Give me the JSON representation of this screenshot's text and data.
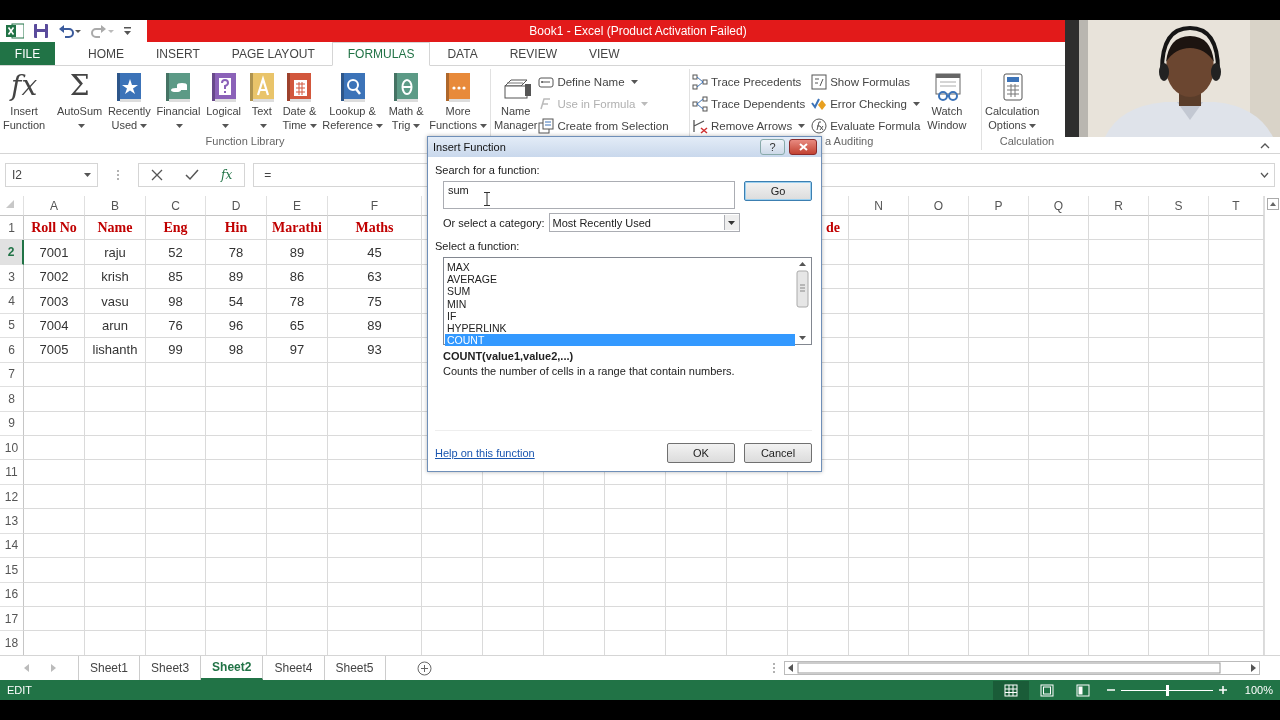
{
  "title_bar": {
    "title": "Book1 - Excel (Product Activation Failed)"
  },
  "ribbon_tabs": [
    {
      "label": "FILE",
      "kind": "file",
      "selected": false
    },
    {
      "label": "HOME",
      "kind": "tab",
      "selected": false
    },
    {
      "label": "INSERT",
      "kind": "tab",
      "selected": false
    },
    {
      "label": "PAGE LAYOUT",
      "kind": "tab",
      "selected": false
    },
    {
      "label": "FORMULAS",
      "kind": "tab",
      "selected": true
    },
    {
      "label": "DATA",
      "kind": "tab",
      "selected": false
    },
    {
      "label": "REVIEW",
      "kind": "tab",
      "selected": false
    },
    {
      "label": "VIEW",
      "kind": "tab",
      "selected": false
    }
  ],
  "ribbon": {
    "groups": [
      {
        "label": "Function Library",
        "items": [
          {
            "kind": "big",
            "glyph": "fx",
            "lines": [
              "Insert",
              "Function"
            ],
            "dropdown": false
          },
          {
            "kind": "big",
            "glyph": "Σ",
            "lines": [
              "AutoSum"
            ],
            "dropdown": true
          },
          {
            "kind": "big",
            "lines": [
              "Recently",
              "Used"
            ],
            "dropdown": true
          },
          {
            "kind": "big",
            "lines": [
              "Financial"
            ],
            "dropdown": true
          },
          {
            "kind": "big",
            "lines": [
              "Logical"
            ],
            "dropdown": true
          },
          {
            "kind": "big",
            "lines": [
              "Text"
            ],
            "dropdown": true
          },
          {
            "kind": "big",
            "lines": [
              "Date &",
              "Time"
            ],
            "dropdown": true
          },
          {
            "kind": "big",
            "lines": [
              "Lookup &",
              "Reference"
            ],
            "dropdown": true
          },
          {
            "kind": "big",
            "lines": [
              "Math &",
              "Trig"
            ],
            "dropdown": true
          },
          {
            "kind": "big",
            "lines": [
              "More",
              "Functions"
            ],
            "dropdown": true
          }
        ]
      },
      {
        "items": [
          {
            "kind": "big",
            "lines": [
              "Name",
              "Manager"
            ],
            "dropdown": false
          },
          {
            "kind": "stack",
            "items": [
              {
                "label": "Define Name",
                "dropdown": true,
                "disabled": false
              },
              {
                "label": "Use in Formula",
                "dropdown": true,
                "disabled": true
              },
              {
                "label": "Create from Selection",
                "dropdown": false,
                "disabled": false
              }
            ]
          }
        ]
      },
      {
        "label": "a Auditing",
        "items": [
          {
            "kind": "stack",
            "items": [
              {
                "label": "Trace Precedents",
                "dropdown": false,
                "disabled": false
              },
              {
                "label": "Trace Dependents",
                "dropdown": false,
                "disabled": false
              },
              {
                "label": "Remove Arrows",
                "dropdown": true,
                "disabled": false
              }
            ]
          },
          {
            "kind": "stack",
            "items": [
              {
                "label": "Show Formulas",
                "dropdown": false,
                "disabled": false
              },
              {
                "label": "Error Checking",
                "dropdown": true,
                "disabled": false
              },
              {
                "label": "Evaluate Formula",
                "dropdown": false,
                "disabled": false
              }
            ]
          },
          {
            "kind": "big",
            "lines": [
              "Watch",
              "Window"
            ],
            "dropdown": false
          }
        ]
      },
      {
        "label": "Calculation",
        "items": [
          {
            "kind": "big",
            "lines": [
              "Calculation",
              "Options"
            ],
            "dropdown": true
          }
        ]
      }
    ]
  },
  "formula_bar": {
    "name_box": "I2",
    "function_glyph": "fx",
    "formula": "="
  },
  "sheet": {
    "left_columns": [
      "A",
      "B",
      "C",
      "D",
      "E",
      "F"
    ],
    "right_columns": [
      "N",
      "O",
      "P",
      "Q",
      "R",
      "S",
      "T"
    ],
    "rows": [
      {
        "number": "1",
        "selected": false,
        "kind": "header",
        "cells": [
          "Roll No",
          "Name",
          "Eng",
          "Hin",
          "Marathi",
          "Maths"
        ],
        "column_m": "de"
      },
      {
        "number": "2",
        "selected": true,
        "kind": "data",
        "cells": [
          "7001",
          "raju",
          "52",
          "78",
          "89",
          "45"
        ]
      },
      {
        "number": "3",
        "selected": false,
        "kind": "data",
        "cells": [
          "7002",
          "krish",
          "85",
          "89",
          "86",
          "63"
        ]
      },
      {
        "number": "4",
        "selected": false,
        "kind": "data",
        "cells": [
          "7003",
          "vasu",
          "98",
          "54",
          "78",
          "75"
        ]
      },
      {
        "number": "5",
        "selected": false,
        "kind": "data",
        "cells": [
          "7004",
          "arun",
          "76",
          "96",
          "65",
          "89"
        ]
      },
      {
        "number": "6",
        "selected": false,
        "kind": "data",
        "cells": [
          "7005",
          "lishanth",
          "99",
          "98",
          "97",
          "93"
        ]
      },
      {
        "number": "7",
        "selected": false
      },
      {
        "number": "8",
        "selected": false
      },
      {
        "number": "9",
        "selected": false
      },
      {
        "number": "10",
        "selected": false
      },
      {
        "number": "11",
        "selected": false
      },
      {
        "number": "12",
        "selected": false
      },
      {
        "number": "13",
        "selected": false
      },
      {
        "number": "14",
        "selected": false
      },
      {
        "number": "15",
        "selected": false
      },
      {
        "number": "16",
        "selected": false
      },
      {
        "number": "17",
        "selected": false
      },
      {
        "number": "18",
        "selected": false
      }
    ]
  },
  "dialog": {
    "title": "Insert Function",
    "help": "?",
    "search_label": "Search for a function:",
    "search_value": "sum",
    "go": "Go",
    "category_label": "Or select a category:",
    "category": "Most Recently Used",
    "function_label": "Select a function:",
    "functions": [
      {
        "name": "MAX",
        "selected": false
      },
      {
        "name": "AVERAGE",
        "selected": false
      },
      {
        "name": "SUM",
        "selected": false
      },
      {
        "name": "MIN",
        "selected": false
      },
      {
        "name": "IF",
        "selected": false
      },
      {
        "name": "HYPERLINK",
        "selected": false
      },
      {
        "name": "COUNT",
        "selected": true
      }
    ],
    "signature": "COUNT(value1,value2,...)",
    "description": "Counts the number of cells in a range that contain numbers.",
    "help_link": "Help on this function",
    "ok": "OK",
    "cancel": "Cancel"
  },
  "sheet_tabs": [
    {
      "label": "Sheet1",
      "selected": false
    },
    {
      "label": "Sheet3",
      "selected": false
    },
    {
      "label": "Sheet2",
      "selected": true
    },
    {
      "label": "Sheet4",
      "selected": false
    },
    {
      "label": "Sheet5",
      "selected": false
    }
  ],
  "status_bar": {
    "mode": "EDIT",
    "views": [
      {
        "selected": true
      },
      {
        "selected": false
      },
      {
        "selected": false
      }
    ],
    "zoom": {
      "level": 0.5,
      "reading": "100%"
    }
  }
}
